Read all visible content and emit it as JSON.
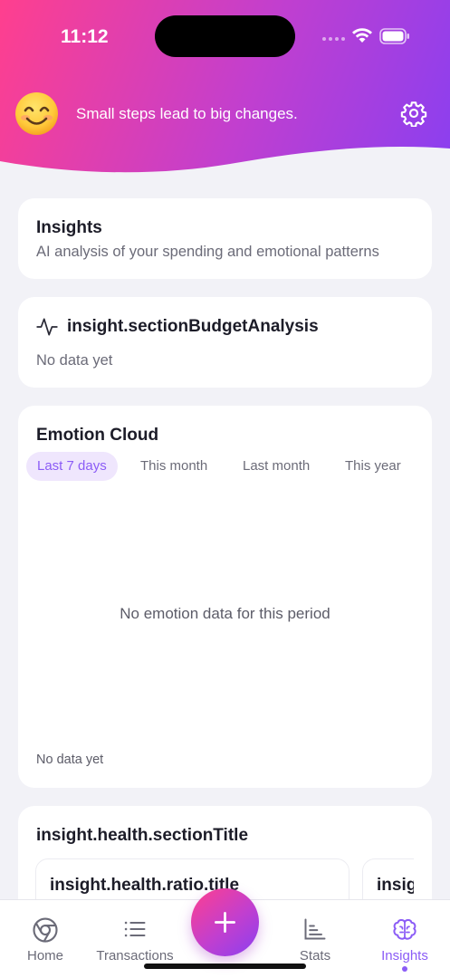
{
  "status_bar": {
    "time": "11:12"
  },
  "header": {
    "tagline": "Small steps lead to big changes.",
    "mascot_icon": "smiling-face-emoji",
    "settings_icon": "gear-icon"
  },
  "insights_card": {
    "title": "Insights",
    "subtitle": "AI analysis of your spending and emotional patterns"
  },
  "budget_card": {
    "icon": "pulse-icon",
    "title": "insight.sectionBudgetAnalysis",
    "empty": "No data yet"
  },
  "emotion_card": {
    "title": "Emotion Cloud",
    "periods": [
      "Last 7 days",
      "This month",
      "Last month",
      "This year"
    ],
    "selected_period": "Last 7 days",
    "empty": "No emotion data for this period",
    "footer": "No data yet"
  },
  "health_card": {
    "title": "insight.health.sectionTitle",
    "items": [
      {
        "title": "insight.health.ratio.title"
      },
      {
        "title": "insig"
      }
    ]
  },
  "tabbar": {
    "tabs": [
      {
        "label": "Home",
        "icon": "home-icon"
      },
      {
        "label": "Transactions",
        "icon": "list-icon"
      },
      {
        "label": "Stats",
        "icon": "bar-chart-icon"
      },
      {
        "label": "Insights",
        "icon": "brain-icon"
      }
    ],
    "active": "Insights",
    "fab_icon": "plus-icon"
  },
  "colors": {
    "accent": "#8b5cf6",
    "gradient_start": "#ff3f8e",
    "gradient_end": "#8a3ff0",
    "background": "#f2f2f7"
  }
}
